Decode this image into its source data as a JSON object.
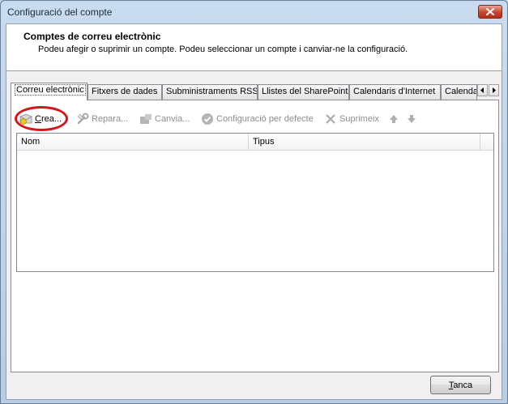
{
  "window": {
    "title": "Configuració del compte"
  },
  "header": {
    "title": "Comptes de correu electrònic",
    "description": "Podeu afegir o suprimir un compte. Podeu seleccionar un compte i canviar-ne la configuració."
  },
  "tabs": [
    {
      "label": "Correu electrònic",
      "active": true
    },
    {
      "label": "Fitxers de dades",
      "active": false
    },
    {
      "label": "Subministraments RSS",
      "active": false
    },
    {
      "label": "Llistes del SharePoint",
      "active": false
    },
    {
      "label": "Calendaris d'Internet",
      "active": false
    },
    {
      "label": "Calenda",
      "active": false
    }
  ],
  "toolbar": {
    "new_label": "Crea...",
    "repair_label": "Repara...",
    "change_label": "Canvia...",
    "default_label": "Configuració per defecte",
    "remove_label": "Suprimeix"
  },
  "list": {
    "columns": [
      "Nom",
      "Tipus"
    ],
    "rows": []
  },
  "footer": {
    "cancel_label": "Tanca"
  },
  "colors": {
    "highlight_ring": "#d9141b",
    "close_button": "#c8432e",
    "window_frame": "#bcd3ea"
  }
}
